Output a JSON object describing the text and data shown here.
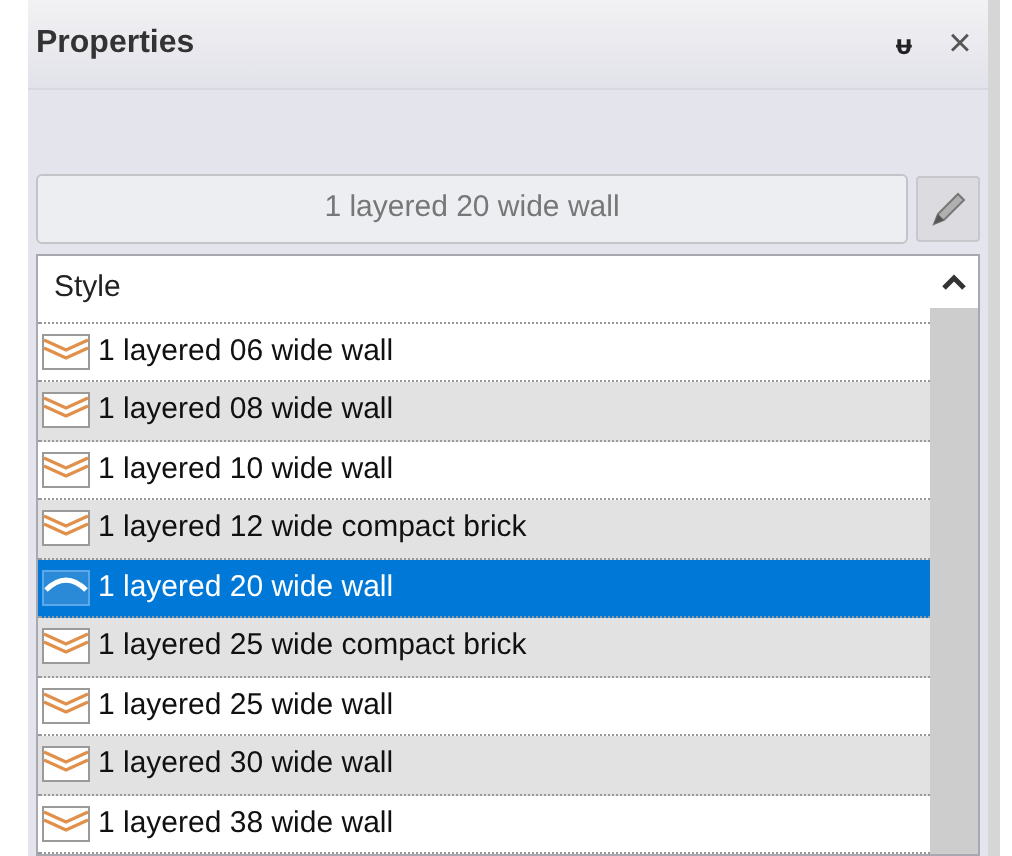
{
  "panel": {
    "title": "Properties",
    "pin": "ᵾ",
    "close": "×"
  },
  "style_field": {
    "value": "1 layered 20 wide wall"
  },
  "list": {
    "header": "Style",
    "rows": [
      {
        "label": "1 layered 06 wide wall",
        "selected": false
      },
      {
        "label": "1 layered 08 wide wall",
        "selected": false
      },
      {
        "label": "1 layered 10 wide wall",
        "selected": false
      },
      {
        "label": "1 layered 12 wide compact brick",
        "selected": false
      },
      {
        "label": "1 layered 20 wide wall",
        "selected": true
      },
      {
        "label": "1 layered 25 wide compact brick",
        "selected": false
      },
      {
        "label": "1 layered 25 wide wall",
        "selected": false
      },
      {
        "label": "1 layered 30 wide wall",
        "selected": false
      },
      {
        "label": "1 layered 38 wide wall",
        "selected": false
      }
    ]
  }
}
